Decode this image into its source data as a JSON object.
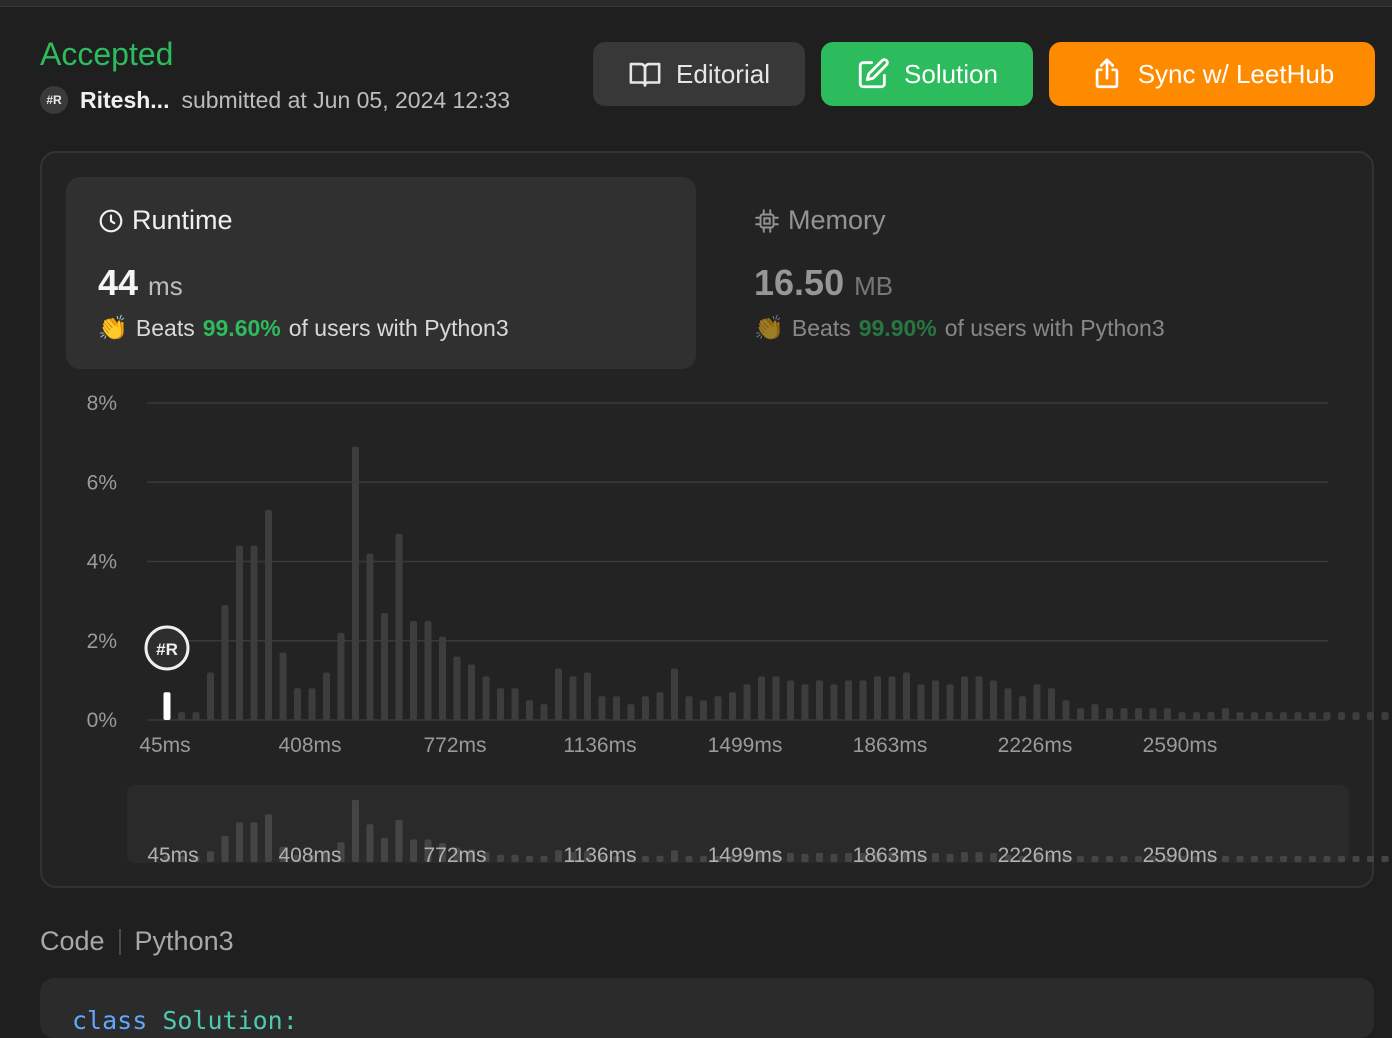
{
  "header": {
    "status": "Accepted",
    "username": "Ritesh...",
    "avatar_text": "#R",
    "submitted_text": "submitted at Jun 05, 2024 12:33"
  },
  "buttons": {
    "editorial": "Editorial",
    "solution": "Solution",
    "sync": "Sync w/ LeetHub"
  },
  "runtime": {
    "title": "Runtime",
    "value": "44",
    "unit": "ms",
    "beats_prefix": "Beats",
    "beats_pct": "99.60%",
    "beats_suffix": "of users with Python3"
  },
  "memory": {
    "title": "Memory",
    "value": "16.50",
    "unit": "MB",
    "beats_prefix": "Beats",
    "beats_pct": "99.90%",
    "beats_suffix": "of users with Python3"
  },
  "colors": {
    "accent_green": "#2cbb5d",
    "sync_orange": "#fe8a00",
    "bar": "#3d3d3d",
    "bar_highlight": "#ffffff"
  },
  "chart_data": {
    "type": "bar",
    "y_ticks": [
      "0%",
      "2%",
      "4%",
      "6%",
      "8%"
    ],
    "ylim": [
      0,
      8
    ],
    "x_ticks": [
      "45ms",
      "408ms",
      "772ms",
      "1136ms",
      "1499ms",
      "1863ms",
      "2226ms",
      "2590ms"
    ],
    "user_bar_index": 0,
    "user_marker": "#R",
    "values": [
      0.7,
      0.2,
      0.2,
      1.2,
      2.9,
      4.4,
      4.4,
      5.3,
      1.7,
      0.8,
      0.8,
      1.2,
      2.2,
      6.9,
      4.2,
      2.7,
      4.7,
      2.5,
      2.5,
      2.1,
      1.6,
      1.4,
      1.1,
      0.8,
      0.8,
      0.5,
      0.4,
      1.3,
      1.1,
      1.2,
      0.6,
      0.6,
      0.4,
      0.6,
      0.7,
      1.3,
      0.6,
      0.5,
      0.6,
      0.7,
      0.9,
      1.1,
      1.1,
      1.0,
      0.9,
      1.0,
      0.9,
      1.0,
      1.0,
      1.1,
      1.1,
      1.2,
      0.9,
      1.0,
      0.9,
      1.1,
      1.1,
      1.0,
      0.8,
      0.6,
      0.9,
      0.8,
      0.5,
      0.3,
      0.4,
      0.3,
      0.3,
      0.3,
      0.3,
      0.3,
      0.2,
      0.2,
      0.2,
      0.3,
      0.2,
      0.2,
      0.2,
      0.2,
      0.2,
      0.2,
      0.2,
      0.2,
      0.2,
      0.2,
      0.2,
      0.2,
      0.2,
      0.2,
      0.2,
      0.2
    ]
  },
  "code": {
    "label": "Code",
    "language": "Python3",
    "first_line_kw": "class",
    "first_line_name": "Solution:"
  }
}
